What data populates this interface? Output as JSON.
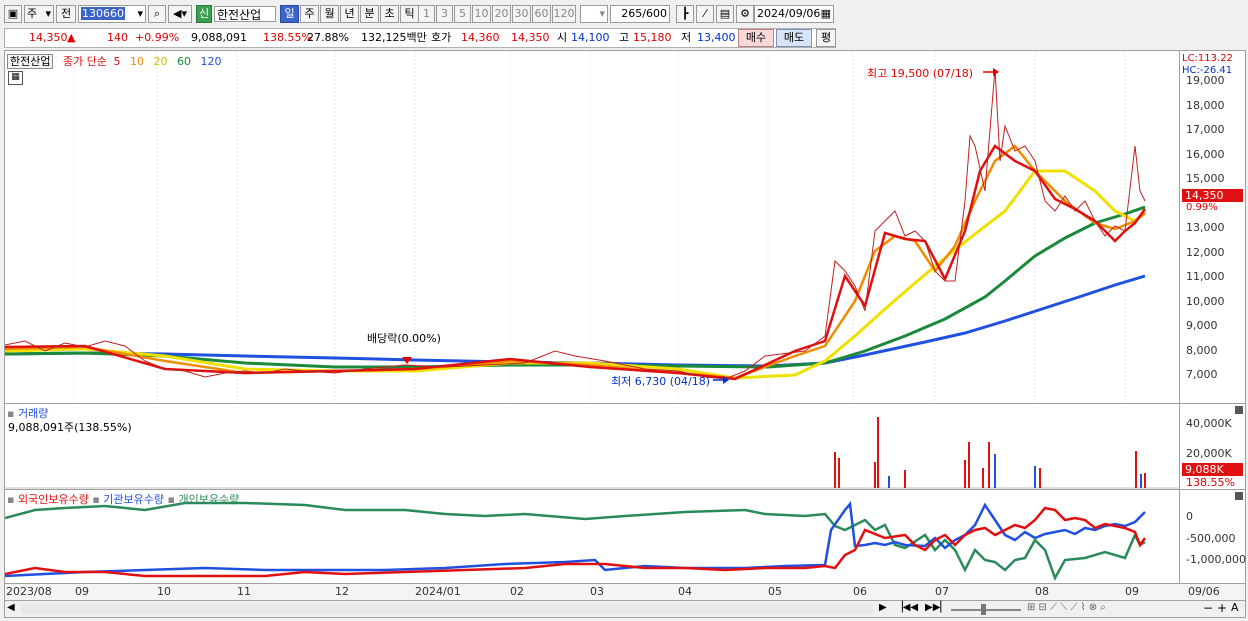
{
  "toolbar1": {
    "market_selector": "주",
    "prev_label": "전",
    "stock_code": "130660",
    "stock_badge": "신",
    "stock_name": "한전산업",
    "periods": [
      "일",
      "주",
      "월",
      "년",
      "분",
      "초",
      "틱"
    ],
    "active_period": "일",
    "num_buttons": [
      "1",
      "3",
      "5",
      "10",
      "20",
      "30",
      "60",
      "120"
    ],
    "count": "265",
    "count_total": "/600",
    "date": "2024/09/06"
  },
  "toolbar2": {
    "price": "14,350",
    "change": "140",
    "change_pct": "+0.99%",
    "volume": "9,088,091",
    "volume_ratio": "138.55%",
    "turnover": "27.88%",
    "amount": "132,125백만",
    "quote_label": "호가",
    "ask": "14,360",
    "bid": "14,350",
    "open_label": "시",
    "open": "14,100",
    "high_label": "고",
    "high": "15,180",
    "low_label": "저",
    "low": "13,400",
    "buy": "매수",
    "sell": "매도",
    "avg": "평"
  },
  "price_panel": {
    "stock_tab": "한전산업",
    "legend_prefix": "종가 단순",
    "ma_labels": [
      "5",
      "10",
      "20",
      "60",
      "120"
    ],
    "ma_colors": [
      "#e01010",
      "#f08c00",
      "#f0e000",
      "#1a8a3a",
      "#2050e0"
    ],
    "lc": "LC:113.22",
    "hc": "HC:-26.41",
    "high_annotation": "최고 19,500 (07/18)",
    "low_annotation": "최저 6,730 (04/18)",
    "dividend_annotation": "배당락(0.00%)",
    "current_price_tag": "14,350",
    "current_pct_tag": "0.99%",
    "y_ticks": [
      "19,000",
      "18,000",
      "17,000",
      "16,000",
      "15,000",
      "13,000",
      "12,000",
      "11,000",
      "10,000",
      "9,000",
      "8,000",
      "7,000"
    ]
  },
  "volume_panel": {
    "title": "거래량",
    "value": "9,088,091주(138.55%)",
    "y_ticks": [
      "40,000K",
      "20,000K"
    ],
    "current_tag": "9,088K",
    "current_pct": "138.55%"
  },
  "holdings_panel": {
    "legend": [
      "외국인보유수량",
      "기관보유수량",
      "개인보유수량"
    ],
    "legend_colors": [
      "#e01010",
      "#2050e0",
      "#2a8a5a"
    ],
    "y_ticks": [
      "0",
      "-500,000",
      "-1,000,000"
    ]
  },
  "x_axis": [
    "2023/08",
    "09",
    "10",
    "11",
    "12",
    "2024/01",
    "02",
    "03",
    "04",
    "05",
    "06",
    "07",
    "08",
    "09",
    "09/06"
  ],
  "chart_data": {
    "type": "candlestick",
    "price_range": [
      6500,
      19700
    ],
    "high_point": {
      "value": 19500,
      "date": "07/18"
    },
    "low_point": {
      "value": 6730,
      "date": "04/18"
    },
    "last_close": 14350,
    "series": [
      {
        "name": "5",
        "color": "#e01010"
      },
      {
        "name": "10",
        "color": "#f08c00"
      },
      {
        "name": "20",
        "color": "#f0e000"
      },
      {
        "name": "60",
        "color": "#1a8a3a"
      },
      {
        "name": "120",
        "color": "#2050e0"
      }
    ],
    "volume_last": 9088091,
    "volume_range": [
      0,
      45000000
    ]
  }
}
